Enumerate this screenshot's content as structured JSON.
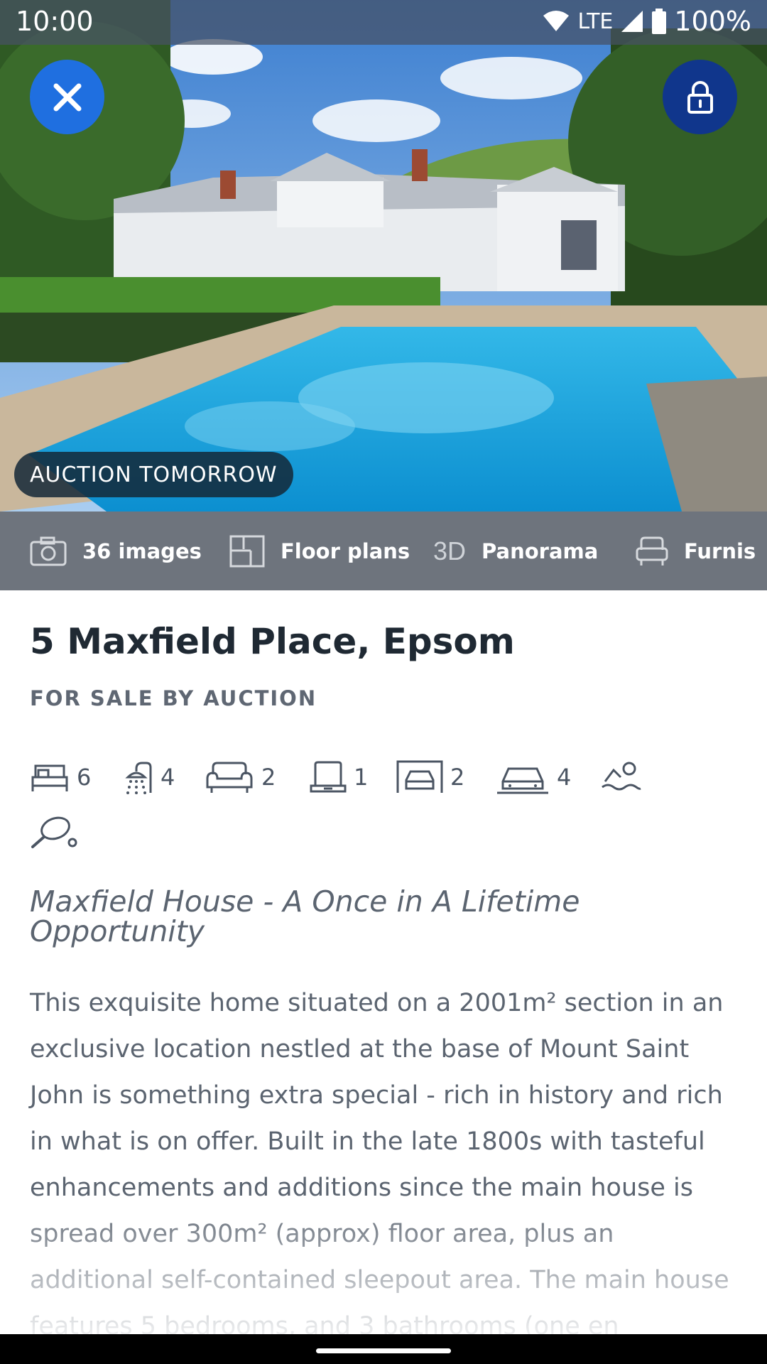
{
  "status_bar": {
    "time": "10:00",
    "network": "LTE",
    "battery": "100%"
  },
  "hero": {
    "badge": "AUCTION TOMORROW"
  },
  "media_bar": {
    "images": "36 images",
    "floor_plans": "Floor plans",
    "three_d": "3D",
    "panorama": "Panorama",
    "furnish": "Furnis"
  },
  "listing": {
    "title": "5 Maxfield Place, Epsom",
    "sale_type": "FOR SALE BY AUCTION",
    "features": {
      "bedrooms": "6",
      "bathrooms": "4",
      "lounges": "2",
      "studies": "1",
      "garages": "2",
      "carparks": "4"
    },
    "tagline": "Maxfield House - A Once in A Lifetime Opportunity",
    "description": "This exquisite home situated on a 2001m² section in an exclusive location nestled at the base of Mount Saint John is something extra special - rich in history and rich in what is on offer. Built in the late 1800s with tasteful enhancements and additions since the main house is spread over 300m² (approx) floor area, plus an additional self-contained sleepout area. The main house features 5 bedrooms, and 3 bathrooms (one en"
  },
  "colors": {
    "close_button": "#1f6fe0",
    "lock_button": "#10368c",
    "media_bar": "#6e747d",
    "title": "#1f2933"
  },
  "icons": [
    "close-icon",
    "lock-icon",
    "camera-icon",
    "floorplan-icon",
    "armchair-icon",
    "bed-icon",
    "shower-icon",
    "sofa-icon",
    "study-icon",
    "garage-icon",
    "car-icon",
    "pool-icon",
    "tennis-icon"
  ]
}
